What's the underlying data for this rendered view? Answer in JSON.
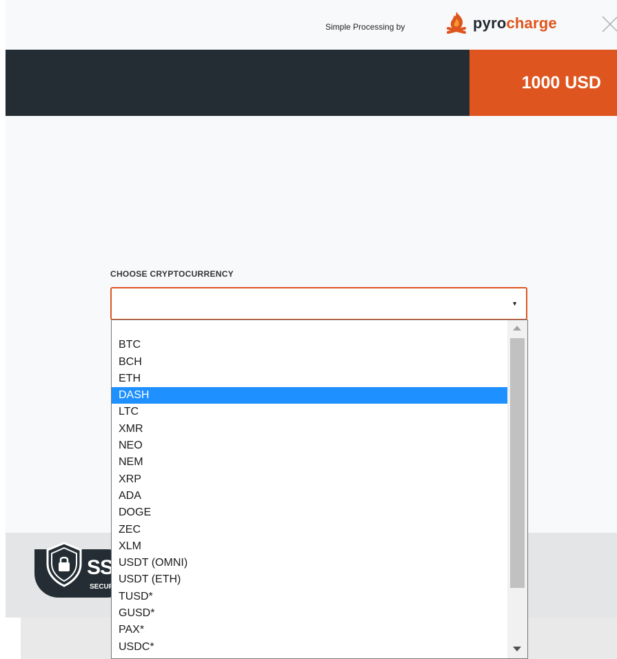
{
  "topbar": {
    "powered_text": "Simple Processing by",
    "brand_part1": "pyro",
    "brand_part2": "charge",
    "close_icon": "close-icon"
  },
  "header": {
    "amount": "1000 USD"
  },
  "form": {
    "choose_label": "CHOOSE CRYPTOCURRENCY",
    "selected_value": ""
  },
  "dropdown": {
    "options": [
      "",
      "BTC",
      "BCH",
      "ETH",
      "DASH",
      "LTC",
      "XMR",
      "NEO",
      "NEM",
      "XRP",
      "ADA",
      "DOGE",
      "ZEC",
      "XLM",
      "USDT (OMNI)",
      "USDT (ETH)",
      "TUSD*",
      "GUSD*",
      "PAX*",
      "USDC*"
    ],
    "highlighted": "DASH"
  },
  "footer": {
    "ssl_text": "SSL",
    "ssl_sub": "SECURE"
  },
  "colors": {
    "accent": "#de5520",
    "dark": "#232d33",
    "highlight": "#1e90ff"
  }
}
